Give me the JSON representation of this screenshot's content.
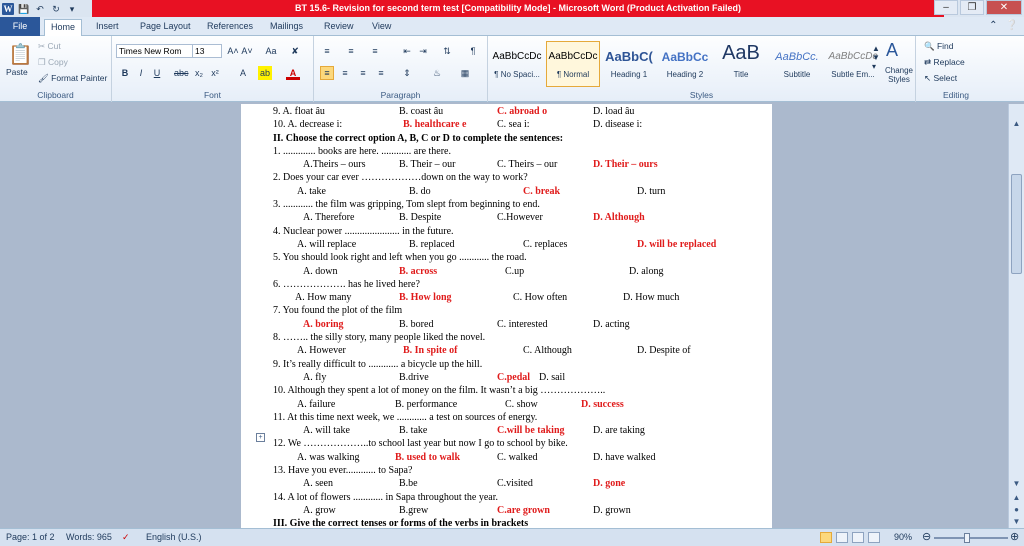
{
  "window": {
    "title": "BT 15.6- Revision for second term test [Compatibility Mode] - Microsoft Word (Product Activation Failed)",
    "colors": {
      "title_bar_alert": "#e81123",
      "file_tab": "#2b579a",
      "answer_red": "#e01b1b"
    }
  },
  "qat": {
    "icons": [
      "word-icon",
      "save-icon",
      "undo-icon",
      "redo-icon",
      "customize-icon"
    ]
  },
  "tabs": [
    {
      "label": "File"
    },
    {
      "label": "Home"
    },
    {
      "label": "Insert"
    },
    {
      "label": "Page Layout"
    },
    {
      "label": "References"
    },
    {
      "label": "Mailings"
    },
    {
      "label": "Review"
    },
    {
      "label": "View"
    }
  ],
  "ribbon": {
    "clipboard": {
      "label": "Clipboard",
      "paste": "Paste",
      "cut": "Cut",
      "copy": "Copy",
      "format_painter": "Format Painter"
    },
    "font": {
      "label": "Font",
      "font_name": "Times New Rom",
      "font_size": "13"
    },
    "paragraph": {
      "label": "Paragraph"
    },
    "styles": {
      "label": "Styles",
      "items": [
        {
          "sample": "AaBbCcDc",
          "name": "¶ No Spaci..."
        },
        {
          "sample": "AaBbCcDc",
          "name": "¶ Normal"
        },
        {
          "sample": "AaBbC(",
          "name": "Heading 1"
        },
        {
          "sample": "AaBbCc",
          "name": "Heading 2"
        },
        {
          "sample": "AaB",
          "name": "Title"
        },
        {
          "sample": "AaBbCc.",
          "name": "Subtitle"
        },
        {
          "sample": "AaBbCcDc",
          "name": "Subtle Em..."
        }
      ],
      "change_styles": "Change Styles"
    },
    "editing": {
      "label": "Editing",
      "find": "Find",
      "replace": "Replace",
      "select": "Select"
    }
  },
  "document": {
    "lines": [
      [
        "9.   A. float    âu",
        "B. coast   âu",
        "C. abroad    o",
        "D. load   âu"
      ],
      [
        "10. A. decrease  i:",
        "B. healthcare   e",
        "C. sea   i:",
        "D. disease   i:"
      ],
      [
        "II. Choose the correct option A, B, C or D to complete the sentences:"
      ],
      [
        "1.      ............. books are here. ............ are there."
      ],
      [
        "A.Theirs – ours",
        "B. Their – our",
        "C. Theirs – our",
        "D. Their – ours"
      ],
      [
        "2.      Does your car ever ………………down on the way to work?"
      ],
      [
        "A. take",
        "B. do",
        "C. break",
        "D. turn"
      ],
      [
        "3.      ............ the film was gripping, Tom slept from beginning to end."
      ],
      [
        "A. Therefore",
        "B. Despite",
        "C.However",
        "D. Although"
      ],
      [
        "4.      Nuclear power ...................... in the future."
      ],
      [
        "A. will replace",
        "B. replaced",
        "C. replaces",
        "D. will be replaced"
      ],
      [
        "5.   You should look right and left when you go ............ the road."
      ],
      [
        "A. down",
        "B. across",
        "C.up",
        "D. along"
      ],
      [
        "6.   ………………. has he lived here?"
      ],
      [
        "A. How many",
        "B. How long",
        "C. How often",
        "D. How much"
      ],
      [
        "7.   You found the plot of the film"
      ],
      [
        "A. boring",
        "B. bored",
        "C. interested",
        "D. acting"
      ],
      [
        "8.      …….. the silly story, many people liked the novel."
      ],
      [
        "A. However",
        "B. In spite of",
        "C. Although",
        "D. Despite of"
      ],
      [
        "9.   It’s really difficult to ............ a bicycle up the hill."
      ],
      [
        "A. fly",
        "B.drive",
        "C.pedal",
        "D. sail"
      ],
      [
        "10.    Although they spent a lot of money on the film. It wasn’t a big ……………….."
      ],
      [
        "A. failure",
        "B. performance",
        "C. show",
        "D. success"
      ],
      [
        "11. At this time next week, we ............ a test on sources of energy."
      ],
      [
        "A. will take",
        "B. take",
        "C.will be taking",
        "D. are taking"
      ],
      [
        "12.    We ………………..to school last year but now I go to school by bike."
      ],
      [
        "A. was walking",
        "B. used to walk",
        "C. walked",
        "D. have walked"
      ],
      [
        "13. Have you ever............ to Sapa?"
      ],
      [
        "A. seen",
        "B.be",
        "C.visited",
        "D. gone"
      ],
      [
        "14. A lot of flowers ............ in Sapa throughout the year."
      ],
      [
        "A. grow",
        "B.grew",
        "C.are grown",
        "D. grown"
      ],
      [
        "III. Give the correct tenses or forms of the verbs in brackets"
      ]
    ]
  },
  "status": {
    "page": "Page: 1 of 2",
    "words": "Words: 965",
    "language": "English (U.S.)",
    "zoom": "90%"
  }
}
